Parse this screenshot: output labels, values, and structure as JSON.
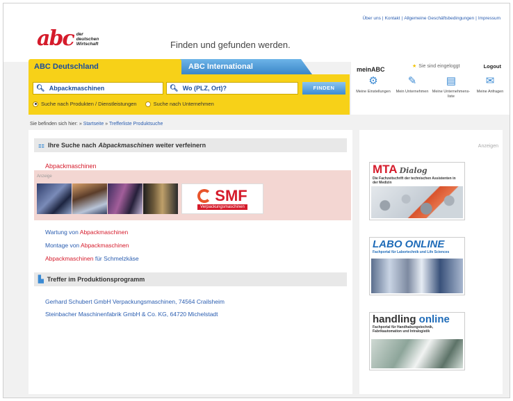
{
  "header": {
    "top_links": [
      "Über uns",
      "|",
      "Kontakt",
      "|",
      "Allgemeine Geschäftsbedingungen",
      "|",
      "Impressum"
    ],
    "logo_text": "abc",
    "logo_sub": [
      "der",
      "deutschen",
      "Wirtschaft"
    ],
    "slogan": "Finden und gefunden werden."
  },
  "tabs": {
    "active": "ABC Deutschland",
    "other": "ABC International"
  },
  "search": {
    "what_value": "Abpackmaschinen",
    "where_placeholder": "Wo (PLZ, Ort)?",
    "button": "FINDEN",
    "radio_products": "Suche nach Produkten / Dienstleistungen",
    "radio_companies": "Suche nach Unternehmen"
  },
  "meinabc": {
    "title": "meinABC",
    "status": "Sie sind eingeloggt",
    "logout": "Logout",
    "items": [
      {
        "label": "Meine Einstellungen",
        "icon": "settings-icon"
      },
      {
        "label": "Mein Unternehmen",
        "icon": "pencil-icon"
      },
      {
        "label": "Meine Unternehmens-liste",
        "icon": "document-icon"
      },
      {
        "label": "Meine Anfragen",
        "icon": "mail-icon"
      }
    ]
  },
  "breadcrumb": {
    "prefix": "Sie befinden sich hier:",
    "items": [
      "Startseite",
      "Trefferliste Produktsuche"
    ]
  },
  "refine": {
    "title_pre": "Ihre Suche nach ",
    "title_kw": "Abpackmaschinen",
    "title_post": " weiter verfeinern",
    "red_link": "Abpackmaschinen",
    "ad_label": "Anzeige",
    "ad_company": "SMF",
    "ad_company_sub": "Verpackungsmaschinen",
    "links": [
      {
        "pre": "Wartung von ",
        "kw": "Abpackmaschinen",
        "post": ""
      },
      {
        "pre": "Montage von ",
        "kw": "Abpackmaschinen",
        "post": ""
      },
      {
        "pre": "",
        "kw": "Abpackmaschinen",
        "post": " für Schmelzkäse"
      }
    ]
  },
  "treffer": {
    "title": "Treffer im Produktionsprogramm",
    "results": [
      "Gerhard Schubert GmbH Verpackungsmaschinen, 74564 Crailsheim",
      "Steinbacher Maschinenfabrik GmbH & Co. KG, 64720 Michelstadt"
    ]
  },
  "sidebar": {
    "label": "Anzeigen",
    "banners": [
      {
        "title_a": "MTA",
        "title_b": "Dialog",
        "sub": "Die Fachzeitschrift der technischen Assistenten in der Medizin"
      },
      {
        "title": "LABO ONLINE",
        "sub": "Fachportal für Labortechnik und Life Sciences"
      },
      {
        "title_a": "handling",
        "title_b": " online",
        "sub": "Fachportal für Handhabungstechnik, Fabrikautomation und Intralogistik"
      }
    ]
  },
  "colors": {
    "yellow": "#f7d118",
    "blue": "#3b8ad3",
    "link": "#2a5db0",
    "red": "#d51b2b"
  }
}
